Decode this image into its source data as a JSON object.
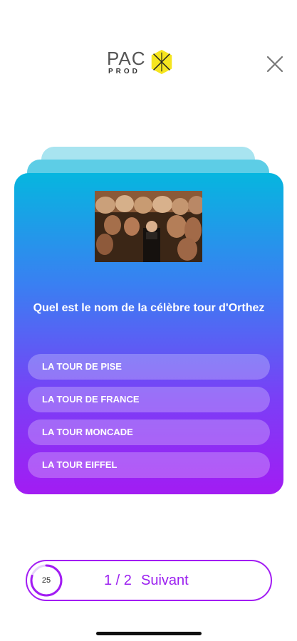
{
  "header": {
    "logo_top": "PAC",
    "logo_bottom": "PROD",
    "logo_mark_icon": "yellow-hexagon-star-icon",
    "close_icon": "close-icon"
  },
  "quiz": {
    "image_icon": "photo-hams-cellar",
    "question": "Quel est le nom de la célèbre tour d'Orthez",
    "answers": [
      {
        "label": "LA TOUR DE PISE"
      },
      {
        "label": "LA TOUR DE FRANCE"
      },
      {
        "label": "LA TOUR MONCADE"
      },
      {
        "label": "LA TOUR EIFFEL"
      }
    ]
  },
  "footer": {
    "timer_value": "25",
    "timer_fraction": 0.8,
    "progress": "1 / 2",
    "next_label": "Suivant"
  },
  "colors": {
    "accent": "#a21cf3",
    "gradient_top": "#06b6df",
    "gradient_bottom": "#a21cf3",
    "logo_yellow": "#f6e51f"
  }
}
